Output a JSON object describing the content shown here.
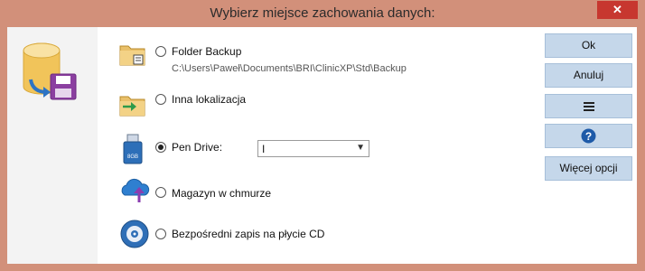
{
  "window": {
    "title": "Wybierz miejsce zachowania danych:",
    "close_glyph": "✕"
  },
  "options": [
    {
      "id": "folder-backup",
      "label": "Folder Backup",
      "path": "C:\\Users\\Paweł\\Documents\\BRI\\ClinicXP\\Std\\Backup",
      "icon": "folder-backup-icon",
      "selected": false
    },
    {
      "id": "inna-lokalizacja",
      "label": "Inna lokalizacja",
      "icon": "folder-arrow-icon",
      "selected": false
    },
    {
      "id": "pen-drive",
      "label": "Pen Drive:",
      "icon": "usb-drive-icon",
      "selected": true
    },
    {
      "id": "magazyn",
      "label": "Magazyn w chmurze",
      "icon": "cloud-upload-icon",
      "selected": false
    },
    {
      "id": "cd",
      "label": "Bezpośredni zapis na płycie CD",
      "icon": "cd-icon",
      "selected": false
    }
  ],
  "pen_drive_select": {
    "value": "I"
  },
  "buttons": {
    "ok": "Ok",
    "anuluj": "Anuluj",
    "menu_icon": "menu-icon",
    "help_icon": "help-icon",
    "more": "Więcej opcji"
  },
  "colors": {
    "titlebar": "#d2907a",
    "button_bg": "#c5d7ea",
    "close": "#c7372f"
  }
}
